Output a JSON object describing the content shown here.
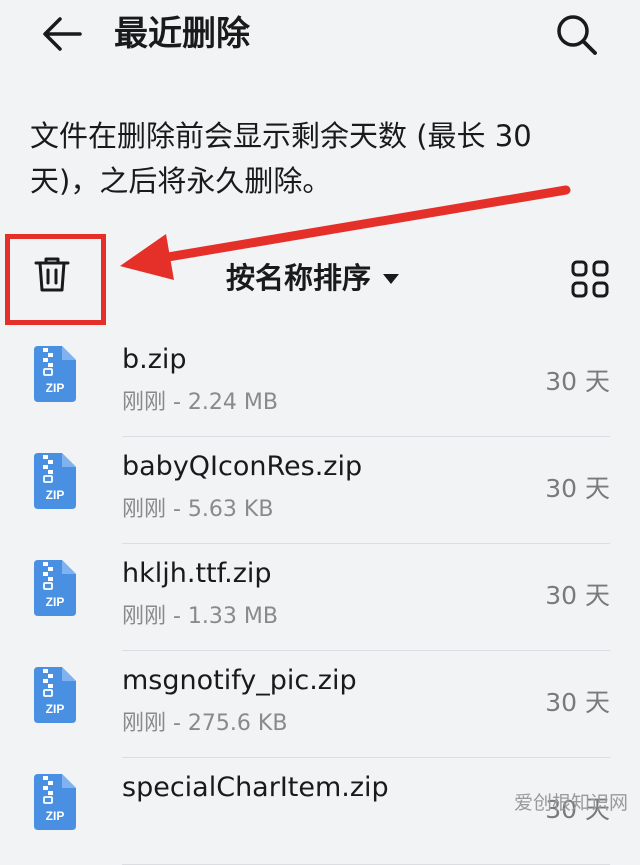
{
  "header": {
    "title": "最近删除",
    "back_icon": "arrow-left-icon",
    "search_icon": "search-icon"
  },
  "description": "文件在删除前会显示剩余天数 (最长 30 天)，之后将永久删除。",
  "toolbar": {
    "trash_icon": "trash-icon",
    "sort_label": "按名称排序",
    "grid_icon": "grid-view-icon"
  },
  "annotation": {
    "color": "#e5302a"
  },
  "files": [
    {
      "name": "b.zip",
      "meta": "刚刚 - 2.24 MB",
      "days": "30 天",
      "icon": "zip-file-icon"
    },
    {
      "name": "babyQIconRes.zip",
      "meta": "刚刚 - 5.63 KB",
      "days": "30 天",
      "icon": "zip-file-icon"
    },
    {
      "name": "hkljh.ttf.zip",
      "meta": "刚刚 - 1.33 MB",
      "days": "30 天",
      "icon": "zip-file-icon"
    },
    {
      "name": "msgnotify_pic.zip",
      "meta": "刚刚 - 275.6 KB",
      "days": "30 天",
      "icon": "zip-file-icon"
    },
    {
      "name": "specialCharItem.zip",
      "meta": "",
      "days": "30 天",
      "icon": "zip-file-icon"
    }
  ],
  "file_icon": {
    "label": "ZIP",
    "color": "#4a90e2"
  },
  "watermark": "爱创根知识网"
}
